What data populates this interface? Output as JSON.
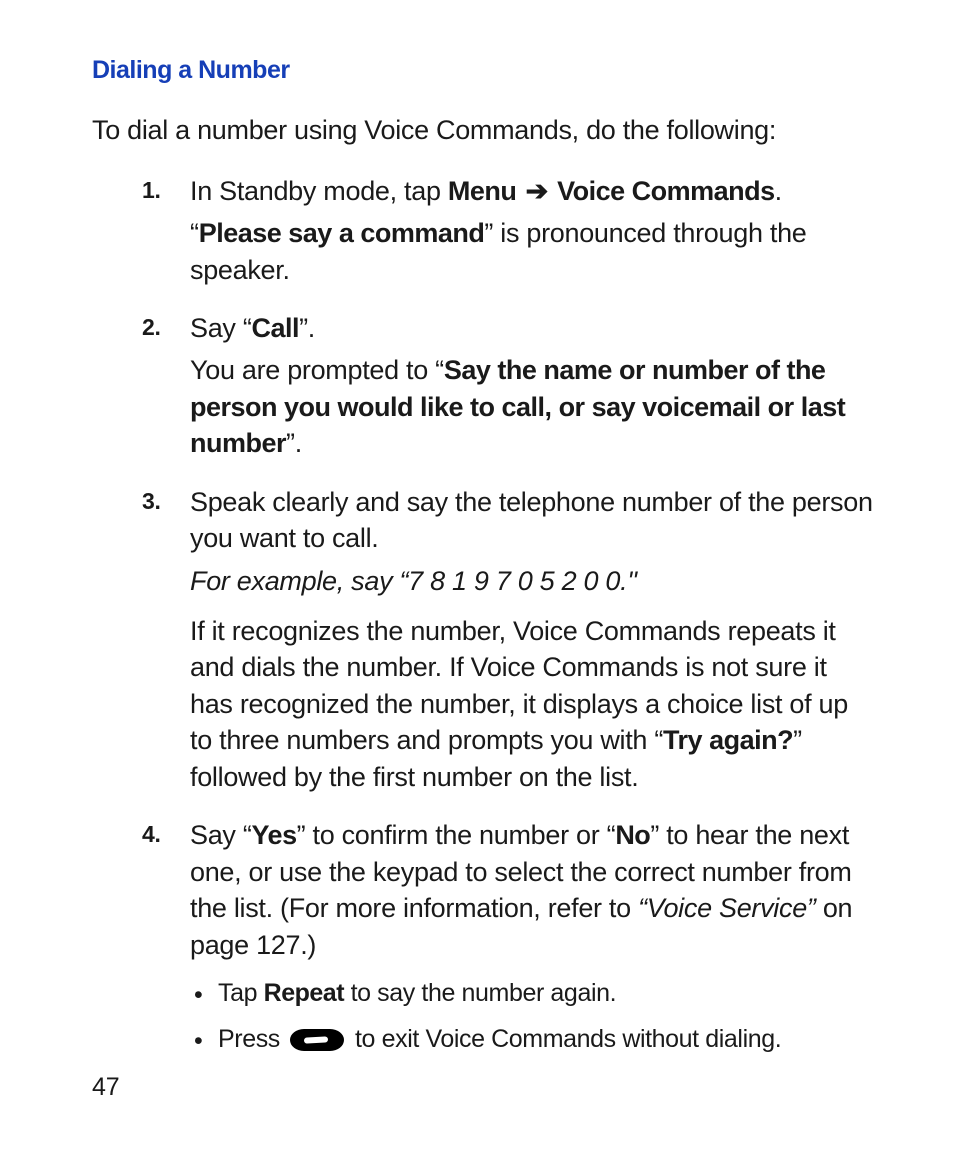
{
  "heading": "Dialing a Number",
  "intro": "To dial a number using Voice Commands, do the following:",
  "steps": {
    "s1": {
      "num": "1.",
      "a": "In Standby mode, tap ",
      "b": "Menu",
      "c": " ➔ ",
      "d": "Voice Commands",
      "e": ".",
      "f": "“",
      "g": "Please say a command",
      "h": "” is pronounced through the speaker."
    },
    "s2": {
      "num": "2.",
      "a": "Say “",
      "b": "Call",
      "c": "”.",
      "d": "You are prompted to “",
      "e": "Say the name or number of the person you would like to call, or say voicemail or last number",
      "f": "”."
    },
    "s3": {
      "num": "3.",
      "a": "Speak clearly and say the telephone number of the person you want to call.",
      "b": "For example, say “7 8 1 9 7 0 5 2 0 0.\"",
      "c": "If it recognizes the number, Voice Commands repeats it and dials the number. If Voice Commands is not sure it has recognized the number, it displays a choice list of up to three numbers and prompts you with “",
      "d": "Try again?",
      "e": "” followed by the first number on the list."
    },
    "s4": {
      "num": "4.",
      "a": "Say “",
      "b": "Yes",
      "c": "” to confirm the number or “",
      "d": "No",
      "e": "” to hear the next one, or use the keypad to select the correct number from the list. (For more information, refer to ",
      "f": "“Voice Service”",
      "g": " on page 127.)",
      "sub1a": "Tap ",
      "sub1b": "Repeat",
      "sub1c": " to say the number again.",
      "sub2a": "Press ",
      "sub2b": " to exit Voice Commands without dialing."
    }
  },
  "pagenum": "47",
  "bullet": "•"
}
